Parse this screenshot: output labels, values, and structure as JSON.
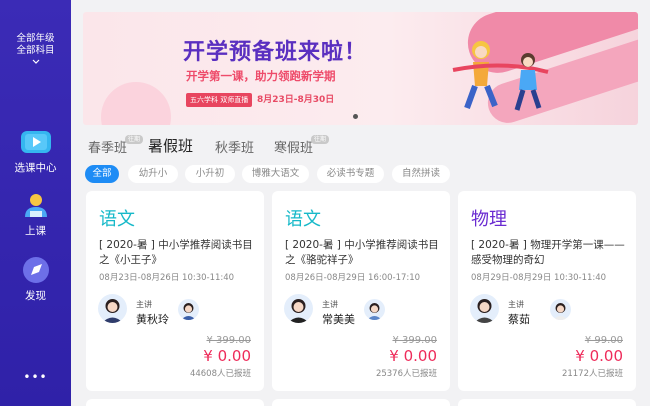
{
  "sidebar": {
    "grade_line1": "全部年级",
    "grade_line2": "全部科目",
    "nav": [
      {
        "label": "选课中心",
        "icon": "play-icon"
      },
      {
        "label": "上课",
        "icon": "user-icon"
      },
      {
        "label": "发现",
        "icon": "compass-icon"
      }
    ],
    "more": "•••"
  },
  "banner": {
    "title": "开学预备班来啦！",
    "subtitle": "开学第一课，助力领跑新学期",
    "tag": "五六学科 双师直播",
    "dates": "8月23日-8月30日"
  },
  "terms": [
    {
      "label": "春季班",
      "badge": "往期"
    },
    {
      "label": "暑假班",
      "badge": ""
    },
    {
      "label": "秋季班",
      "badge": ""
    },
    {
      "label": "寒假班",
      "badge": "往期"
    }
  ],
  "chips": [
    "全部",
    "幼升小",
    "小升初",
    "博雅大语文",
    "必读书专题",
    "自然拼读"
  ],
  "courses": [
    {
      "subject": "语文",
      "subject_color": "#17b9c9",
      "title": "[ 2020-暑 ] 中小学推荐阅读书目之《小王子》",
      "date": "08月23日-08月26日 10:30-11:40",
      "role": "主讲",
      "teacher": "黄秋玲",
      "original_price": "¥ 399.00",
      "price": "¥ 0.00",
      "enrolled": "44608人已报班"
    },
    {
      "subject": "语文",
      "subject_color": "#17b9c9",
      "title": "[ 2020-暑 ] 中小学推荐阅读书目之《骆驼祥子》",
      "date": "08月26日-08月29日 16:00-17:10",
      "role": "主讲",
      "teacher": "常美美",
      "original_price": "¥ 399.00",
      "price": "¥ 0.00",
      "enrolled": "25376人已报班"
    },
    {
      "subject": "物理",
      "subject_color": "#6a2bd1",
      "title": "[ 2020-暑 ] 物理开学第一课——感受物理的奇幻",
      "date": "08月29日-08月29日 10:30-11:40",
      "role": "主讲",
      "teacher": "蔡茹",
      "original_price": "¥ 99.00",
      "price": "¥ 0.00",
      "enrolled": "21172人已报班"
    }
  ],
  "colors": {
    "sidebar": "#3326ae",
    "accent": "#1e8cf5",
    "price": "#ee2b5a"
  }
}
